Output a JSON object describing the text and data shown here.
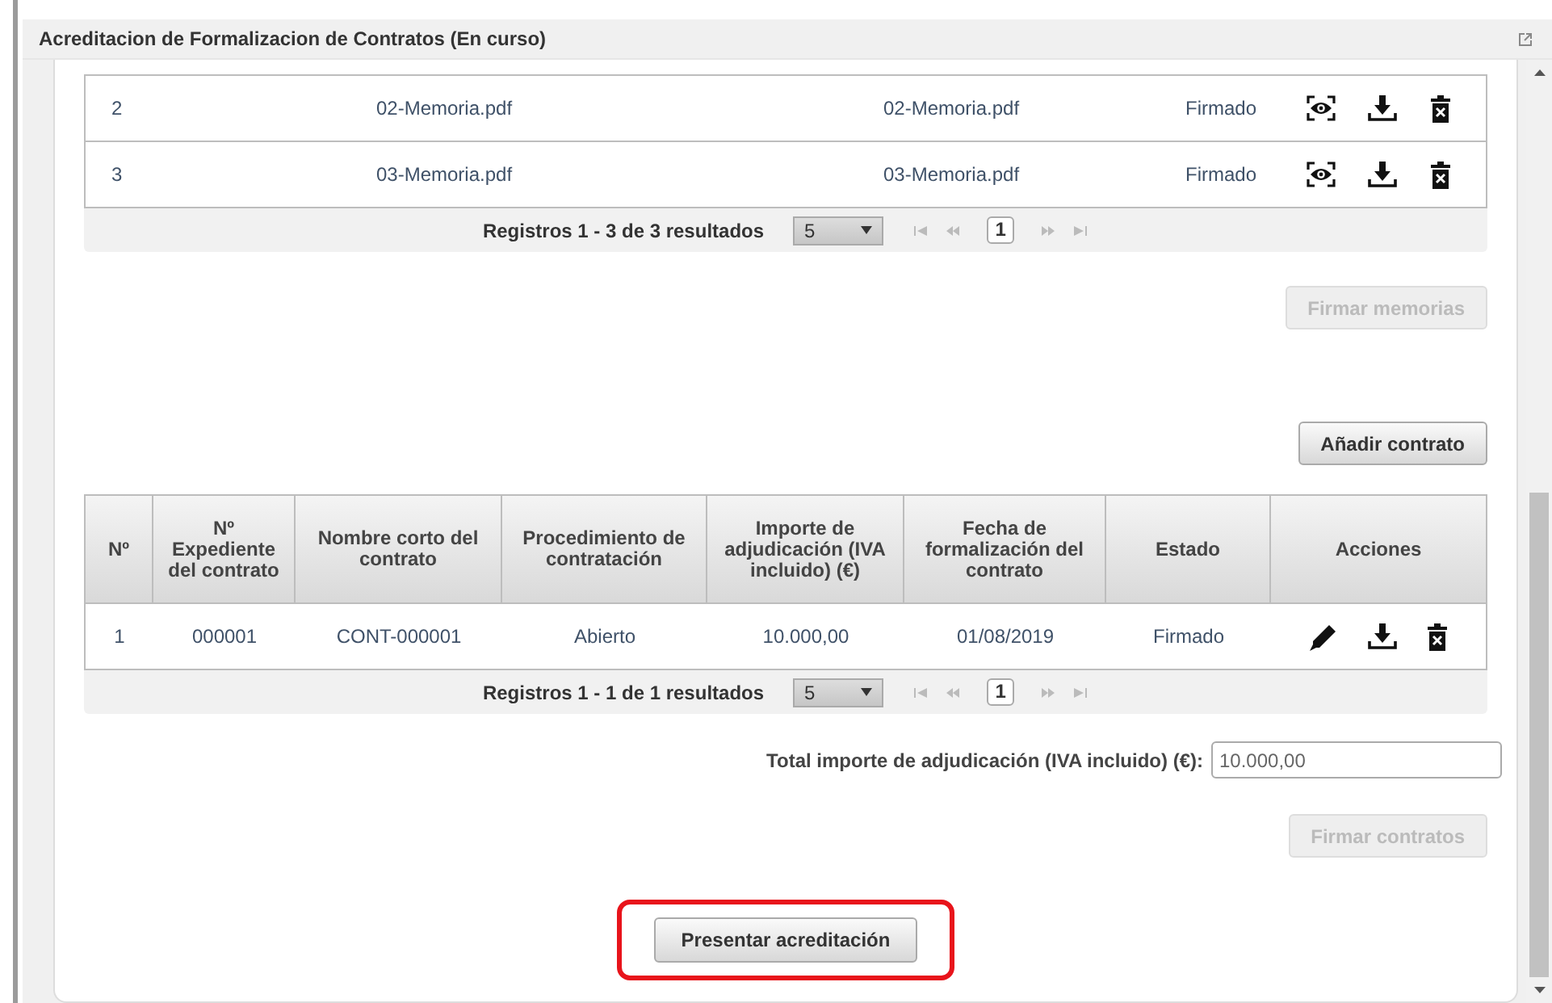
{
  "window": {
    "title": "Acreditacion de Formalizacion de Contratos (En curso)"
  },
  "memorias": {
    "rows": [
      {
        "number": "2",
        "name": "02-Memoria.pdf",
        "file": "02-Memoria.pdf",
        "status": "Firmado"
      },
      {
        "number": "3",
        "name": "03-Memoria.pdf",
        "file": "03-Memoria.pdf",
        "status": "Firmado"
      }
    ],
    "pager": {
      "summary": "Registros 1 - 3 de 3 resultados",
      "page_size": "5",
      "pages": [
        {
          "label": "1",
          "selected": true
        }
      ]
    }
  },
  "sign_memorias_button": {
    "label": "Firmar memorias",
    "disabled": true
  },
  "add_contract_button": {
    "label": "Añadir contrato",
    "disabled": false
  },
  "contratos": {
    "columns": [
      "Nº",
      "Nº Expediente del contrato",
      "Nombre corto del contrato",
      "Procedimiento de contratación",
      "Importe de adjudicación (IVA incluido) (€)",
      "Fecha de formalización del contrato",
      "Estado",
      "Acciones"
    ],
    "rows": [
      {
        "cells": [
          "1",
          "000001",
          "CONT-000001",
          "Abierto",
          "10.000,00",
          "01/08/2019",
          "Firmado"
        ]
      }
    ],
    "pager": {
      "summary": "Registros 1 - 1 de 1 resultados",
      "page_size": "5",
      "pages": [
        {
          "label": "1",
          "selected": true
        }
      ]
    }
  },
  "total": {
    "label": "Total importe de adjudicación (IVA incluido) (€):",
    "value": "10.000,00"
  },
  "sign_contracts_button": {
    "label": "Firmar contratos",
    "disabled": true
  },
  "submit_button": {
    "label": "Presentar acreditación",
    "disabled": false,
    "highlighted": true
  }
}
